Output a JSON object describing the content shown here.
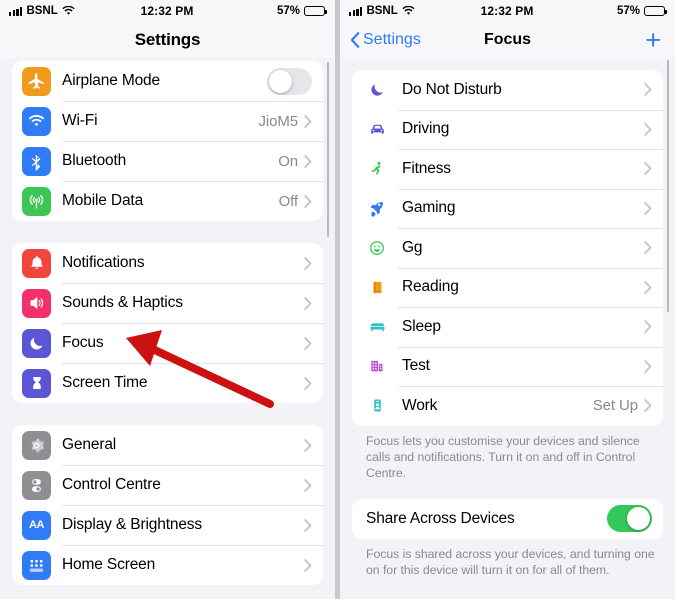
{
  "status_bar": {
    "carrier": "BSNL",
    "time": "12:32 PM",
    "battery_pct": "57%",
    "signal_icon": "cellular-bars-icon",
    "wifi_icon": "wifi-icon",
    "battery_icon": "battery-icon"
  },
  "left_screen": {
    "title": "Settings",
    "groups": [
      {
        "rows": [
          {
            "label": "Airplane Mode",
            "icon": "airplane-icon",
            "icon_bg": "#f29a1b",
            "accessory": "toggle",
            "toggle_on": false
          },
          {
            "label": "Wi-Fi",
            "icon": "wifi-icon",
            "icon_bg": "#2f7cf6",
            "accessory": "chevron",
            "value": "JioM5"
          },
          {
            "label": "Bluetooth",
            "icon": "bluetooth-icon",
            "icon_bg": "#2f7cf6",
            "accessory": "chevron",
            "value": "On"
          },
          {
            "label": "Mobile Data",
            "icon": "mobile-data-icon",
            "icon_bg": "#3cc755",
            "accessory": "chevron",
            "value": "Off"
          }
        ]
      },
      {
        "rows": [
          {
            "label": "Notifications",
            "icon": "bell-icon",
            "icon_bg": "#f2453d",
            "accessory": "chevron",
            "value": ""
          },
          {
            "label": "Sounds & Haptics",
            "icon": "speaker-icon",
            "icon_bg": "#f2306a",
            "accessory": "chevron",
            "value": ""
          },
          {
            "label": "Focus",
            "icon": "moon-icon",
            "icon_bg": "#5a56d6",
            "accessory": "chevron",
            "value": ""
          },
          {
            "label": "Screen Time",
            "icon": "hourglass-icon",
            "icon_bg": "#5a56d6",
            "accessory": "chevron",
            "value": ""
          }
        ]
      },
      {
        "rows": [
          {
            "label": "General",
            "icon": "gear-icon",
            "icon_bg": "#8e8e93",
            "accessory": "chevron",
            "value": ""
          },
          {
            "label": "Control Centre",
            "icon": "control-centre-icon",
            "icon_bg": "#8e8e93",
            "accessory": "chevron",
            "value": ""
          },
          {
            "label": "Display & Brightness",
            "icon": "aa-text-icon",
            "icon_bg": "#2f7cf6",
            "accessory": "chevron",
            "value": ""
          },
          {
            "label": "Home Screen",
            "icon": "home-screen-grid-icon",
            "icon_bg": "#2f7cf6",
            "accessory": "chevron",
            "value": ""
          }
        ]
      }
    ]
  },
  "right_screen": {
    "back_label": "Settings",
    "title": "Focus",
    "add_label": "+",
    "focus_items": [
      {
        "label": "Do Not Disturb",
        "icon": "moon-icon",
        "color": "#5a56d6",
        "glyph": "☾",
        "value": ""
      },
      {
        "label": "Driving",
        "icon": "car-icon",
        "color": "#5a56d6",
        "glyph": "🚗",
        "value": ""
      },
      {
        "label": "Fitness",
        "icon": "running-icon",
        "color": "#34c759",
        "glyph": "🏃",
        "value": ""
      },
      {
        "label": "Gaming",
        "icon": "rocket-icon",
        "color": "#2f7cf6",
        "glyph": "🚀",
        "value": ""
      },
      {
        "label": "Gg",
        "icon": "smiley-icon",
        "color": "#34c759",
        "glyph": "☺",
        "value": ""
      },
      {
        "label": "Reading",
        "icon": "book-icon",
        "color": "#f29a1b",
        "glyph": "📙",
        "value": ""
      },
      {
        "label": "Sleep",
        "icon": "bed-icon",
        "color": "#25c3c3",
        "glyph": "🛏",
        "value": ""
      },
      {
        "label": "Test",
        "icon": "building-icon",
        "color": "#c051d8",
        "glyph": "🏢",
        "value": ""
      },
      {
        "label": "Work",
        "icon": "id-card-icon",
        "color": "#25c3c3",
        "glyph": "📇",
        "value": "Set Up"
      }
    ],
    "focus_footnote": "Focus lets you customise your devices and silence calls and notifications. Turn it on and off in Control Centre.",
    "share_row": {
      "label": "Share Across Devices",
      "toggle_on": true,
      "toggle_color": "#34c759"
    },
    "share_footnote": "Focus is shared across your devices, and turning one on for this device will turn it on for all of them."
  },
  "annotation": {
    "arrow_color": "#cc1111",
    "arrow_name": "red-pointer-arrow"
  }
}
